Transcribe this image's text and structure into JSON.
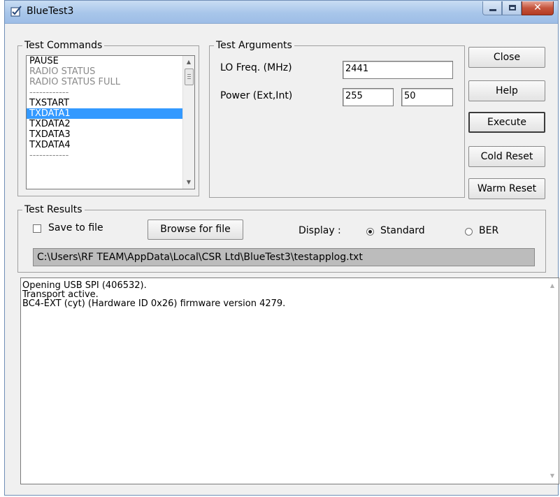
{
  "window": {
    "title": "BlueTest3",
    "icons": {
      "app": "checkbox-check-icon",
      "minimize": "minimize-icon",
      "maximize": "maximize-icon",
      "close": "close-icon"
    }
  },
  "test_commands": {
    "legend": "Test Commands",
    "items": [
      {
        "label": "PAUSE",
        "state": "normal"
      },
      {
        "label": "RADIO STATUS",
        "state": "grey"
      },
      {
        "label": "RADIO STATUS FULL",
        "state": "grey"
      },
      {
        "label": "------------",
        "state": "grey"
      },
      {
        "label": "TXSTART",
        "state": "normal"
      },
      {
        "label": "TXDATA1",
        "state": "selected"
      },
      {
        "label": "TXDATA2",
        "state": "normal"
      },
      {
        "label": "TXDATA3",
        "state": "normal"
      },
      {
        "label": "TXDATA4",
        "state": "normal"
      },
      {
        "label": "------------",
        "state": "grey"
      }
    ],
    "scroll_up": "▲",
    "scroll_down": "▼"
  },
  "test_arguments": {
    "legend": "Test Arguments",
    "lo_freq_label": "LO Freq. (MHz)",
    "lo_freq_value": "2441",
    "power_label": "Power (Ext,Int)",
    "power_ext_value": "255",
    "power_int_value": "50"
  },
  "buttons": {
    "close": "Close",
    "help": "Help",
    "execute": "Execute",
    "cold_reset": "Cold Reset",
    "warm_reset": "Warm Reset"
  },
  "test_results": {
    "legend": "Test Results",
    "save_to_file_label": "Save to file",
    "save_to_file_checked": false,
    "browse_button": "Browse for file",
    "display_label": "Display :",
    "display_options": [
      "Standard",
      "BER"
    ],
    "display_selected": "Standard",
    "log_path": "C:\\Users\\RF TEAM\\AppData\\Local\\CSR Ltd\\BlueTest3\\testapplog.txt"
  },
  "output": {
    "lines": [
      "Opening USB SPI (406532).",
      "Transport active.",
      "BC4-EXT (cyt) (Hardware ID 0x26) firmware version 4279."
    ],
    "scroll_up": "▲",
    "scroll_down": "▼"
  }
}
